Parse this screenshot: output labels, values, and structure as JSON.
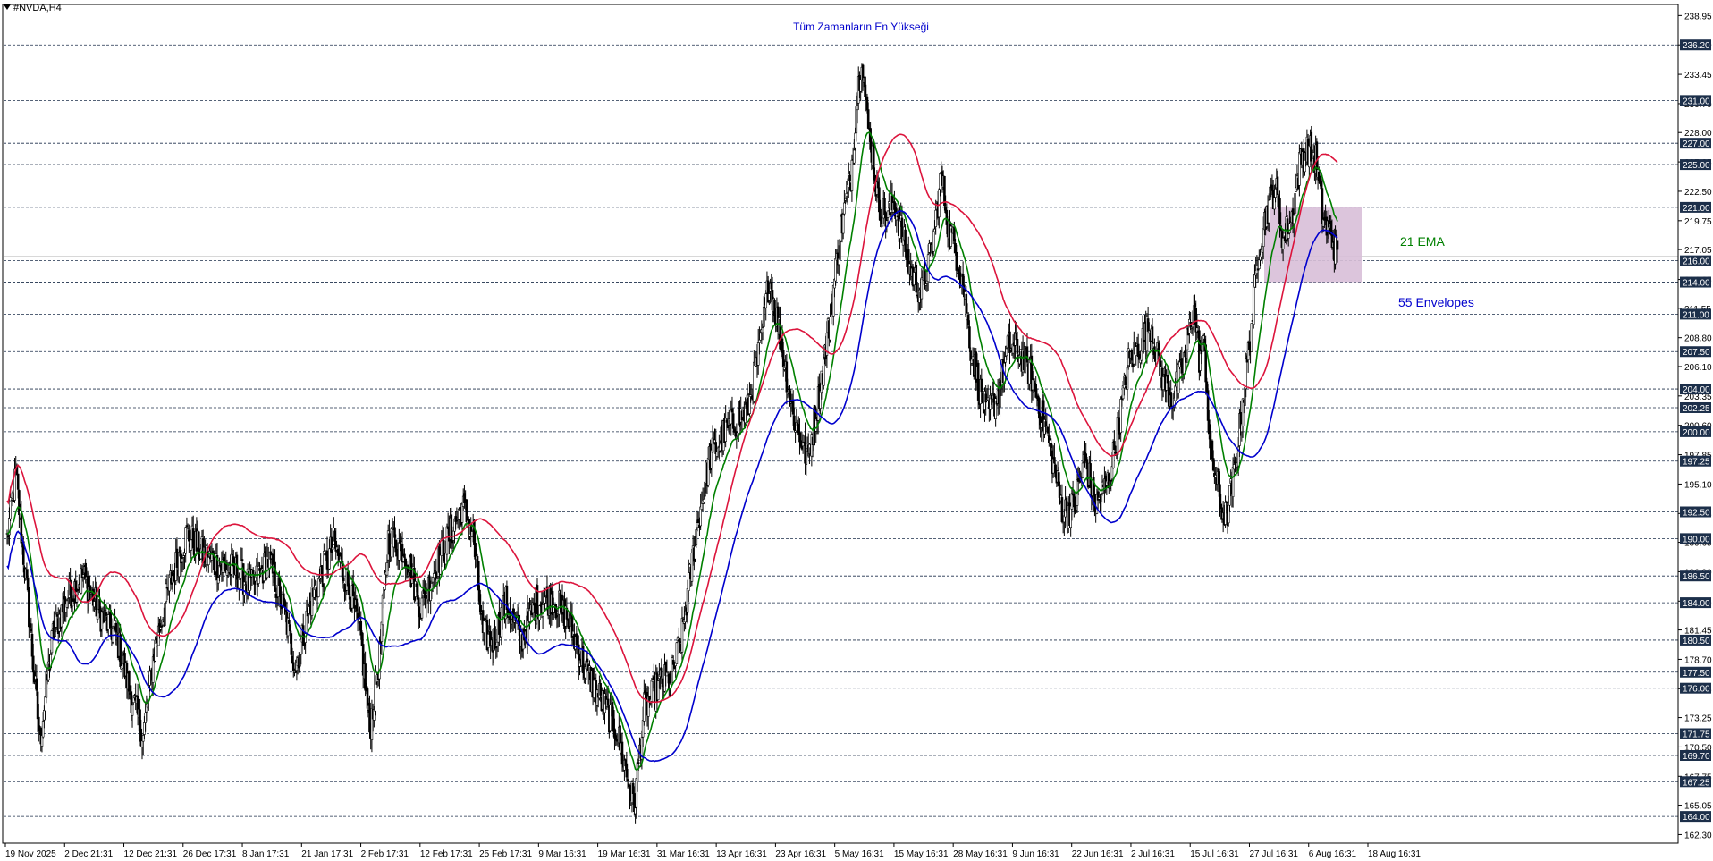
{
  "window": {
    "symbol_label": "#NVDA,H4"
  },
  "annotations": {
    "ath_label": "Tüm Zamanların En Yükseği",
    "ema_label": "21 EMA",
    "envelope_label": "55 Envelopes"
  },
  "colors": {
    "background": "#ffffff",
    "candle": "#000000",
    "ema_line": "#008000",
    "envelope_upper": "#dc143c",
    "envelope_lower": "#0000cd",
    "ath_text": "#0000cd",
    "zone_fill": "#d8bfd8",
    "price_tag_bg": "#1c2f4a",
    "price_tag_text": "#ffffff",
    "level_line": "#1c2f4a"
  },
  "chart_data": {
    "type": "candlestick",
    "title": "#NVDA,H4",
    "ylim": [
      161.5,
      239.9
    ],
    "y_ticks": [
      162.3,
      165.05,
      167.75,
      170.5,
      173.25,
      175.95,
      178.7,
      181.45,
      184.15,
      186.9,
      189.65,
      192.35,
      195.1,
      197.85,
      200.6,
      203.35,
      206.1,
      208.8,
      211.55,
      214.25,
      217.05,
      219.75,
      222.5,
      225.25,
      228.0,
      230.7,
      233.45,
      236.2,
      238.95
    ],
    "x_ticks": [
      "19 Nov 2025",
      "2 Dec 21:31",
      "12 Dec 21:31",
      "26 Dec 17:31",
      "8 Jan 17:31",
      "21 Jan 17:31",
      "2 Feb 17:31",
      "12 Feb 17:31",
      "25 Feb 17:31",
      "9 Mar 16:31",
      "19 Mar 16:31",
      "31 Mar 16:31",
      "13 Apr 16:31",
      "23 Apr 16:31",
      "5 May 16:31",
      "15 May 16:31",
      "28 May 16:31",
      "9 Jun 16:31",
      "22 Jun 16:31",
      "2 Jul 16:31",
      "15 Jul 16:31",
      "27 Jul 16:31",
      "6 Aug 16:31",
      "18 Aug 16:31"
    ],
    "horizontal_levels": [
      "236.20",
      "231.00",
      "227.00",
      "225.00",
      "221.00",
      "216.00",
      "214.00",
      "211.00",
      "207.50",
      "204.00",
      "202.25",
      "200.00",
      "197.25",
      "192.50",
      "190.00",
      "186.50",
      "184.00",
      "180.50",
      "177.50",
      "176.00",
      "171.75",
      "169.70",
      "167.25",
      "164.00"
    ],
    "current_price": 216.4,
    "zone": {
      "price_top": 221.0,
      "price_bottom": 214.0
    },
    "price_path": [
      [
        0,
        190.0
      ],
      [
        8,
        196.0
      ],
      [
        20,
        183.0
      ],
      [
        30,
        171.0
      ],
      [
        42,
        181.0
      ],
      [
        55,
        184.5
      ],
      [
        70,
        186.5
      ],
      [
        85,
        183.0
      ],
      [
        100,
        181.0
      ],
      [
        112,
        176.0
      ],
      [
        125,
        171.5
      ],
      [
        135,
        179.5
      ],
      [
        150,
        186.0
      ],
      [
        165,
        190.5
      ],
      [
        180,
        188.5
      ],
      [
        195,
        187.5
      ],
      [
        210,
        187.0
      ],
      [
        225,
        185.5
      ],
      [
        240,
        188.0
      ],
      [
        255,
        183.0
      ],
      [
        265,
        178.0
      ],
      [
        280,
        184.5
      ],
      [
        300,
        189.5
      ],
      [
        315,
        185.0
      ],
      [
        325,
        180.5
      ],
      [
        333,
        172.0
      ],
      [
        342,
        179.0
      ],
      [
        350,
        190.0
      ],
      [
        365,
        189.0
      ],
      [
        380,
        183.5
      ],
      [
        392,
        187.0
      ],
      [
        405,
        190.0
      ],
      [
        418,
        193.0
      ],
      [
        428,
        190.5
      ],
      [
        437,
        181.0
      ],
      [
        447,
        180.5
      ],
      [
        458,
        184.0
      ],
      [
        472,
        180.5
      ],
      [
        486,
        184.0
      ],
      [
        500,
        184.5
      ],
      [
        515,
        182.5
      ],
      [
        530,
        178.0
      ],
      [
        545,
        175.0
      ],
      [
        560,
        172.0
      ],
      [
        570,
        167.5
      ],
      [
        576,
        165.0
      ],
      [
        585,
        174.0
      ],
      [
        600,
        176.5
      ],
      [
        610,
        177.0
      ],
      [
        620,
        181.0
      ],
      [
        632,
        190.0
      ],
      [
        645,
        197.5
      ],
      [
        660,
        200.0
      ],
      [
        680,
        202.0
      ],
      [
        692,
        208.0
      ],
      [
        700,
        214.5
      ],
      [
        710,
        209.0
      ],
      [
        722,
        201.5
      ],
      [
        735,
        197.5
      ],
      [
        745,
        203.0
      ],
      [
        755,
        210.0
      ],
      [
        765,
        218.5
      ],
      [
        775,
        224.0
      ],
      [
        780,
        230.5
      ],
      [
        785,
        235.5
      ],
      [
        790,
        229.0
      ],
      [
        795,
        226.0
      ],
      [
        800,
        221.5
      ],
      [
        808,
        220.0
      ],
      [
        815,
        221.5
      ],
      [
        822,
        218.5
      ],
      [
        830,
        215.0
      ],
      [
        840,
        213.0
      ],
      [
        850,
        217.5
      ],
      [
        858,
        224.0
      ],
      [
        865,
        219.0
      ],
      [
        870,
        217.5
      ],
      [
        878,
        214.0
      ],
      [
        885,
        208.0
      ],
      [
        893,
        204.0
      ],
      [
        900,
        201.5
      ],
      [
        910,
        203.5
      ],
      [
        920,
        208.0
      ],
      [
        930,
        207.5
      ],
      [
        940,
        205.5
      ],
      [
        948,
        202.5
      ],
      [
        955,
        200.0
      ],
      [
        962,
        196.5
      ],
      [
        970,
        192.5
      ],
      [
        980,
        193.0
      ],
      [
        990,
        197.5
      ],
      [
        1000,
        193.0
      ],
      [
        1012,
        195.5
      ],
      [
        1020,
        200.0
      ],
      [
        1030,
        206.5
      ],
      [
        1040,
        208.0
      ],
      [
        1050,
        210.0
      ],
      [
        1060,
        205.5
      ],
      [
        1070,
        203.0
      ],
      [
        1080,
        206.0
      ],
      [
        1090,
        212.0
      ],
      [
        1095,
        207.0
      ],
      [
        1100,
        208.0
      ],
      [
        1105,
        198.0
      ],
      [
        1110,
        196.0
      ],
      [
        1115,
        193.0
      ],
      [
        1120,
        192.0
      ],
      [
        1128,
        196.5
      ],
      [
        1135,
        203.0
      ],
      [
        1142,
        209.0
      ],
      [
        1150,
        217.5
      ],
      [
        1158,
        221.0
      ],
      [
        1165,
        223.0
      ],
      [
        1172,
        218.0
      ],
      [
        1180,
        220.0
      ],
      [
        1188,
        225.5
      ],
      [
        1195,
        226.5
      ],
      [
        1202,
        225.5
      ],
      [
        1208,
        220.5
      ],
      [
        1212,
        219.0
      ],
      [
        1216,
        218.5
      ],
      [
        1222,
        216.5
      ]
    ],
    "series": [
      {
        "name": "21 EMA",
        "color": "#008000",
        "period": 21
      },
      {
        "name": "55 Envelopes",
        "color": "#dc143c",
        "band": "upper",
        "period": 55,
        "deviation_pct": 1.6
      },
      {
        "name": "55 Envelopes",
        "color": "#0000cd",
        "band": "lower",
        "period": 55,
        "deviation_pct": 1.6
      }
    ],
    "grid": false
  }
}
